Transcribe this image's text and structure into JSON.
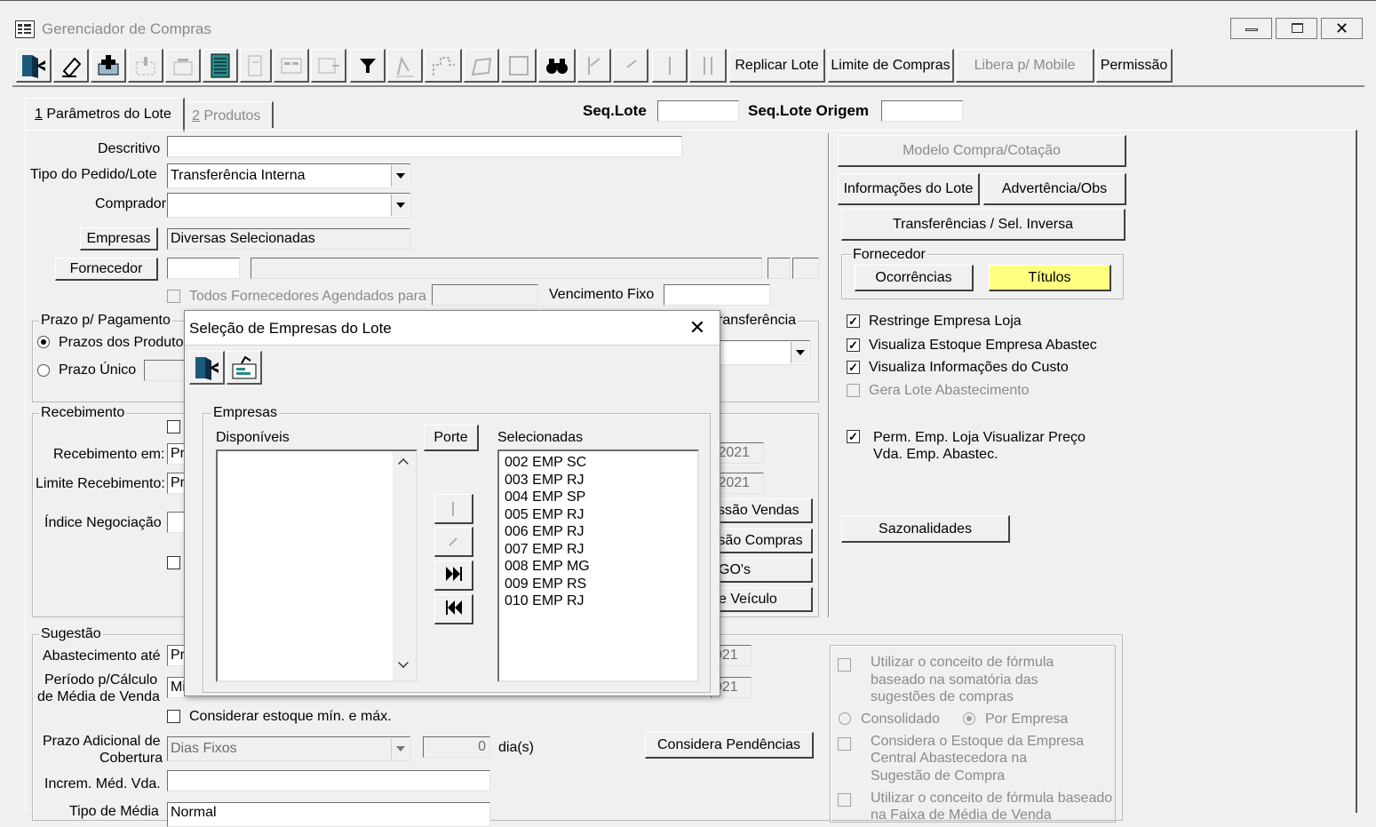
{
  "window": {
    "title": "Gerenciador de Compras"
  },
  "toolbar": {
    "icons": [
      "exit-icon",
      "eraser-icon",
      "add-icon",
      "cut-icon",
      "remove-icon",
      "notebook-icon",
      "copy-icon",
      "form-icon",
      "form-add-icon",
      "filter-icon",
      "pencil-icon",
      "puzzle-icon",
      "shape-icon",
      "blank-icon",
      "binoculars-icon",
      "first-icon",
      "prev-icon",
      "next-icon",
      "last-icon"
    ],
    "replicar_lote": "Replicar Lote",
    "limite_compras": "Limite de Compras",
    "libera_mobile": "Libera p/ Mobile",
    "permissao": "Permissão"
  },
  "tabs": {
    "tab1_num": "1",
    "tab1_label": "Parâmetros do Lote",
    "tab2_num": "2",
    "tab2_label": "Produtos"
  },
  "header": {
    "seq_lote_label": "Seq.Lote",
    "seq_lote_origem_label": "Seq.Lote Origem"
  },
  "form": {
    "descritivo_label": "Descritivo",
    "tipo_label": "Tipo do Pedido/Lote",
    "tipo_value": "Transferência Interna",
    "comprador_label": "Comprador",
    "empresas_button": "Empresas",
    "empresas_value": "Diversas Selecionadas",
    "fornecedor_button": "Fornecedor",
    "todos_fornecedores": "Todos Fornecedores Agendados para",
    "vencimento_fixo": "Vencimento Fixo",
    "prazo_group": "Prazo p/ Pagamento",
    "prazos_produtos": "Prazos dos Produtos",
    "prazo_unico": "Prazo Único",
    "transferencia_partial": "ransferência",
    "recebimento_group": "Recebimento",
    "recebimento_em": "Recebimento em:",
    "recebimento_em_value": "Pr",
    "limite_recebimento": "Limite Recebimento:",
    "limite_recebimento_value": "Pr",
    "indice_negociacao": "Índice Negociação",
    "date1_partial": "/2021",
    "date2_partial": "/2021",
    "btn_emissao_vendas": "issão Vendas",
    "btn_emissao_compras": "ssão Compras",
    "btn_gos": "GO's",
    "btn_veiculo": "e Veículo",
    "sugestao_group": "Sugestão",
    "abastecimento_ate": "Abastecimento até",
    "abastecimento_value": "Pr",
    "periodo_calc_1": "Período p/Cálculo",
    "periodo_calc_2": "de Média de Venda",
    "periodo_value": "Mi",
    "date3_partial": "021",
    "date4_partial": "021",
    "considerar_estoque": "Considerar estoque mín. e máx.",
    "prazo_adicional_1": "Prazo Adicional de",
    "prazo_adicional_2": "Cobertura",
    "prazo_adicional_value": "Dias Fixos",
    "prazo_adicional_num": "0",
    "dias_label": "dia(s)",
    "considera_pendencias": "Considera Pendências",
    "increm_med_vda": "Increm. Méd. Vda.",
    "tipo_media": "Tipo de Média",
    "tipo_media_value": "Normal"
  },
  "right_panel": {
    "modelo_compra": "Modelo Compra/Cotação",
    "informacoes_lote": "Informações do Lote",
    "advertencia": "Advertência/Obs",
    "transferencias": "Transferências / Sel. Inversa",
    "fornecedor_group": "Fornecedor",
    "ocorrencias": "Ocorrências",
    "titulos": "Títulos",
    "restringe_empresa": "Restringe Empresa Loja",
    "visualiza_estoque": "Visualiza Estoque Empresa Abastec",
    "visualiza_custo": "Visualiza Informações do Custo",
    "gera_lote": "Gera Lote Abastecimento",
    "perm_emp_1": "Perm. Emp. Loja Visualizar Preço",
    "perm_emp_2": "Vda. Emp. Abastec.",
    "sazonalidades": "Sazonalidades",
    "formula_1": "Utilizar o conceito de fórmula",
    "formula_2": "baseado na somatória das",
    "formula_3": "sugestões de compras",
    "consolidado": "Consolidado",
    "por_empresa": "Por Empresa",
    "considera_estoque_1": "Considera o Estoque da Empresa",
    "considera_estoque_2": "Central Abastecedora na",
    "considera_estoque_3": "Sugestão de Compra",
    "formula_media_1": "Utilizar o conceito de fórmula baseado",
    "formula_media_2": "na Faixa de Média de Venda"
  },
  "dialog": {
    "title": "Seleção de Empresas do Lote",
    "group_label": "Empresas",
    "disponiveis_label": "Disponíveis",
    "porte_button": "Porte",
    "selecionadas_label": "Selecionadas",
    "selecionadas": [
      "002 EMP SC",
      "003 EMP RJ",
      "004 EMP SP",
      "005 EMP RJ",
      "006 EMP RJ",
      "007 EMP RJ",
      "008 EMP MG",
      "009 EMP RS",
      "010 EMP RJ"
    ]
  },
  "colors": {
    "titulos_bg": "#ffff80",
    "window_bg": "#f0f0f0"
  }
}
